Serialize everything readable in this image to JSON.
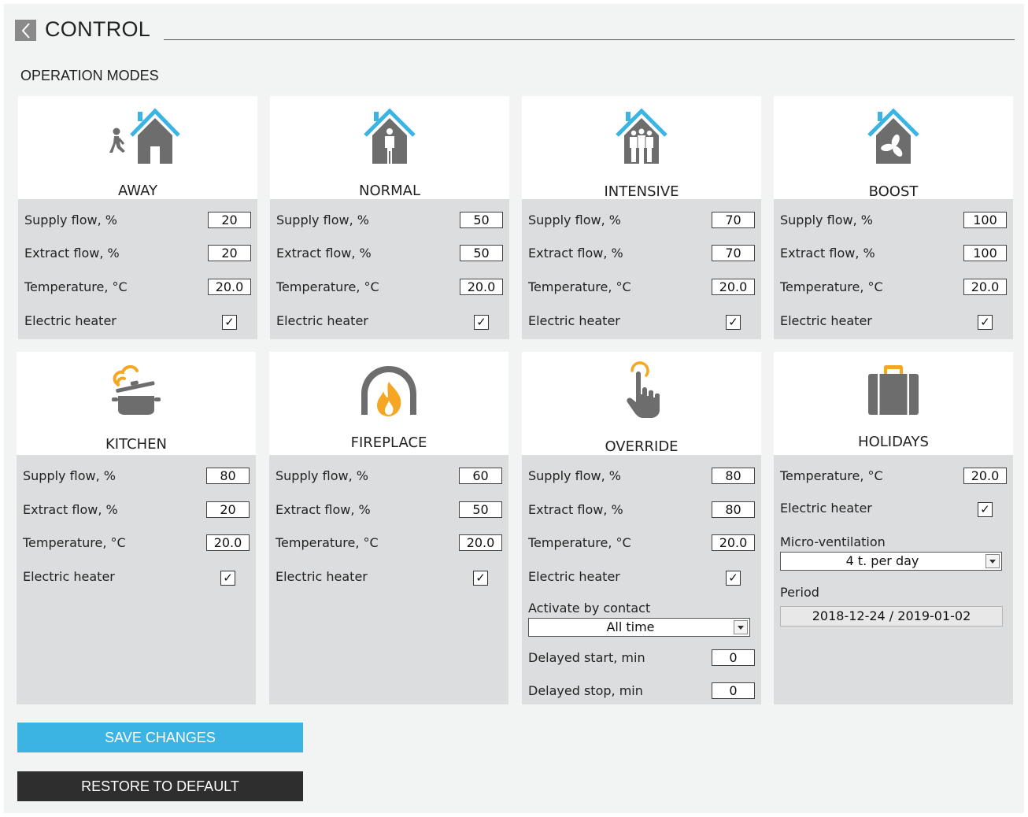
{
  "header": {
    "title": "CONTROL",
    "section_title": "OPERATION MODES"
  },
  "modes": [
    {
      "name": "AWAY",
      "icon": "away-house-icon",
      "supply": "20",
      "extract": "20",
      "temp": "20.0",
      "heater": true
    },
    {
      "name": "NORMAL",
      "icon": "normal-house-icon",
      "supply": "50",
      "extract": "50",
      "temp": "20.0",
      "heater": true
    },
    {
      "name": "INTENSIVE",
      "icon": "intensive-house-icon",
      "supply": "70",
      "extract": "70",
      "temp": "20.0",
      "heater": true
    },
    {
      "name": "BOOST",
      "icon": "boost-house-fan-icon",
      "supply": "100",
      "extract": "100",
      "temp": "20.0",
      "heater": true
    },
    {
      "name": "KITCHEN",
      "icon": "kitchen-pot-icon",
      "supply": "80",
      "extract": "20",
      "temp": "20.0",
      "heater": true
    },
    {
      "name": "FIREPLACE",
      "icon": "fireplace-icon",
      "supply": "60",
      "extract": "50",
      "temp": "20.0",
      "heater": true
    },
    {
      "name": "OVERRIDE",
      "icon": "override-hand-icon",
      "supply": "80",
      "extract": "80",
      "temp": "20.0",
      "heater": true,
      "activate_value": "All time",
      "delayed_start": "0",
      "delayed_stop": "0"
    },
    {
      "name": "HOLIDAYS",
      "icon": "holidays-suitcase-icon",
      "temp": "20.0",
      "heater": true,
      "micro_value": "4 t. per day",
      "period": "2018-12-24 / 2019-01-02"
    }
  ],
  "labels": {
    "supply": "Supply flow, %",
    "extract": "Extract flow, %",
    "temp": "Temperature, °C",
    "heater": "Electric heater",
    "activate": "Activate by contact",
    "delayed_start": "Delayed start, min",
    "delayed_stop": "Delayed stop, min",
    "micro": "Micro-ventilation",
    "period": "Period",
    "check": "✓"
  },
  "buttons": {
    "save": "SAVE CHANGES",
    "restore": "RESTORE TO DEFAULT"
  },
  "colors": {
    "accent": "#3bb3e3",
    "icon_gray": "#6d6d6d",
    "icon_orange": "#f5a623",
    "card_body": "#dcddde"
  }
}
